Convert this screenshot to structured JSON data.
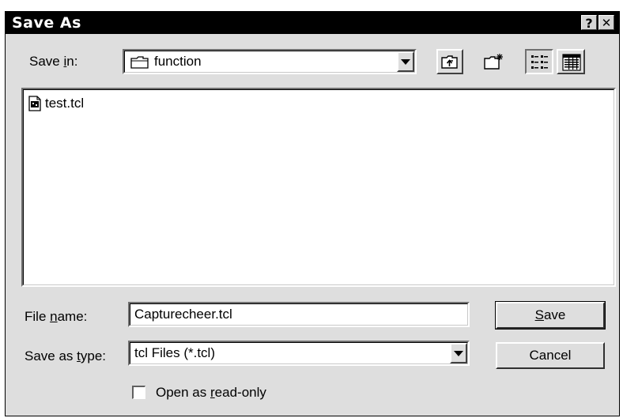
{
  "window": {
    "title": "Save As",
    "help_glyph": "?",
    "close_glyph": "✕"
  },
  "save_in": {
    "label_pre": "Save ",
    "label_accel": "i",
    "label_post": "n:",
    "value": "function"
  },
  "files": [
    {
      "name": "test.tcl",
      "icon": "tcl-file-icon"
    }
  ],
  "file_name": {
    "label_pre": "File ",
    "label_accel": "n",
    "label_post": "ame:",
    "value": "Capturecheer.tcl"
  },
  "save_type": {
    "label_pre": "Save as ",
    "label_accel": "t",
    "label_post": "ype:",
    "value": "tcl Files (*.tcl)"
  },
  "buttons": {
    "save_accel": "S",
    "save_rest": "ave",
    "cancel": "Cancel"
  },
  "read_only": {
    "label_pre": "Open as ",
    "label_accel": "r",
    "label_post": "ead-only",
    "checked": false
  },
  "toolbar": {
    "up_one_level": "up-folder-icon",
    "new_folder": "new-folder-icon",
    "list_view": "list-view-icon",
    "details_view": "details-view-icon"
  }
}
